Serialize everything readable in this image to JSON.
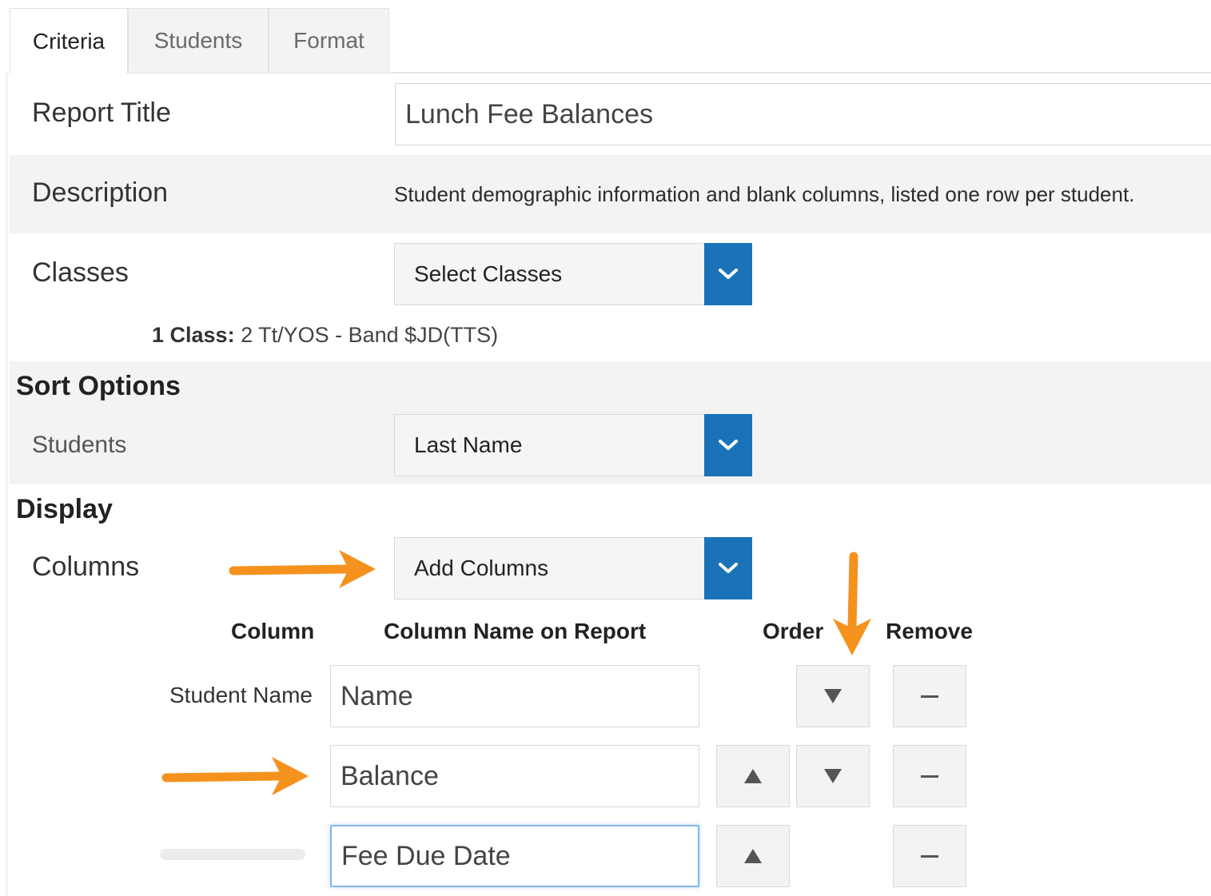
{
  "tabs": [
    {
      "label": "Criteria",
      "active": true
    },
    {
      "label": "Students",
      "active": false
    },
    {
      "label": "Format",
      "active": false
    }
  ],
  "report_title": {
    "label": "Report Title",
    "value": "Lunch Fee Balances"
  },
  "description": {
    "label": "Description",
    "text": "Student demographic information and blank columns, listed one row per student."
  },
  "classes": {
    "label": "Classes",
    "select_value": "Select Classes",
    "note_bold": "1 Class:",
    "note_text": " 2 Tt/YOS - Band $JD(TTS)"
  },
  "sort_options": {
    "heading": "Sort Options",
    "students_label": "Students",
    "students_value": "Last Name"
  },
  "display": {
    "heading": "Display",
    "columns_label": "Columns",
    "add_columns_value": "Add Columns",
    "headers": {
      "column": "Column",
      "column_name": "Column Name on Report",
      "order": "Order",
      "remove": "Remove"
    },
    "rows": [
      {
        "column": "Student Name",
        "name": "Name"
      },
      {
        "column": "",
        "name": "Balance"
      },
      {
        "column": "",
        "name": "Fee Due Date"
      }
    ]
  },
  "colors": {
    "accent": "#1a73b8",
    "annotation_arrow": "#f5921e",
    "band": "#f3f3f3"
  }
}
